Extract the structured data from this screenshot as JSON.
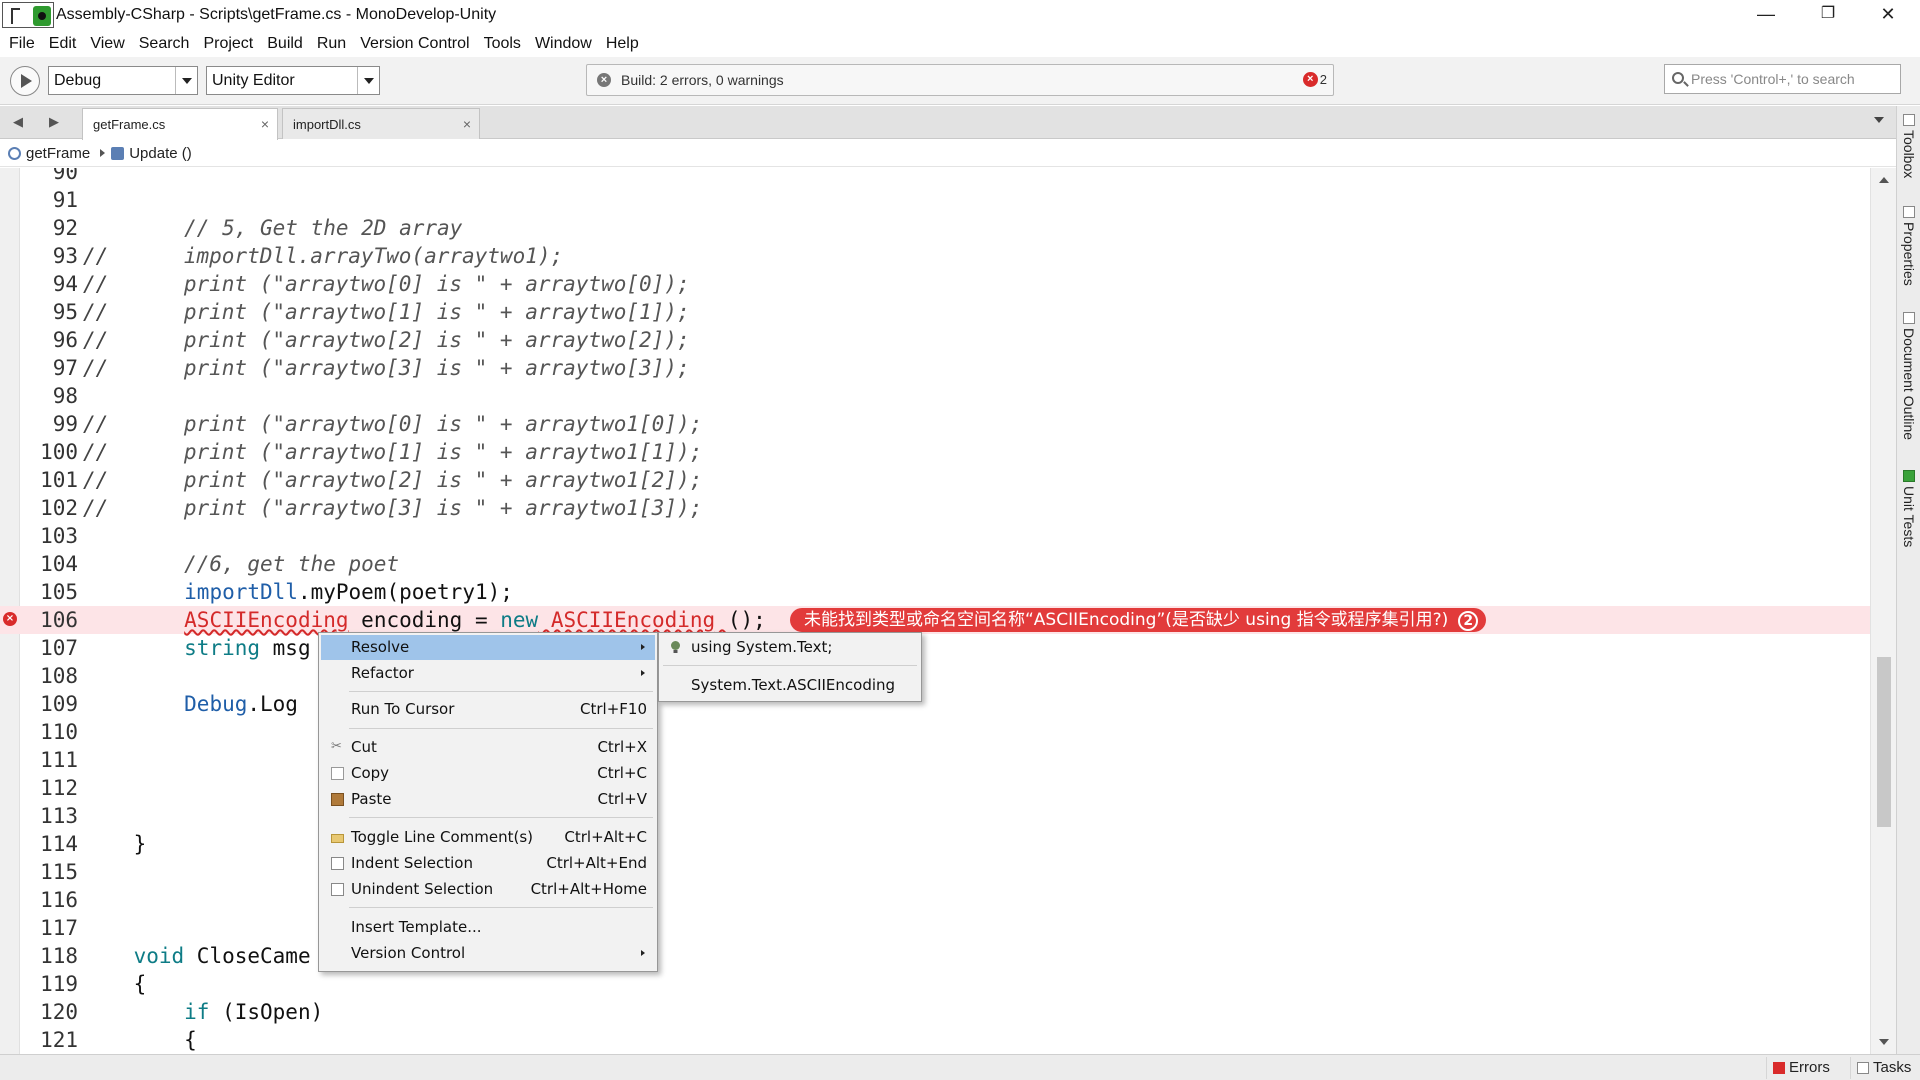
{
  "window": {
    "title": "Assembly-CSharp - Scripts\\getFrame.cs - MonoDevelop-Unity",
    "minimize": "—",
    "maximize": "❐",
    "close": "✕"
  },
  "menu": [
    "File",
    "Edit",
    "View",
    "Search",
    "Project",
    "Build",
    "Run",
    "Version Control",
    "Tools",
    "Window",
    "Help"
  ],
  "toolbar": {
    "configuration": "Debug",
    "target": "Unity Editor",
    "status_text": "Build: 2 errors, 0 warnings",
    "error_count": "2",
    "search_placeholder": "Press 'Control+,' to search"
  },
  "tabs": [
    {
      "label": "getFrame.cs",
      "close": "×",
      "active": true
    },
    {
      "label": "importDll.cs",
      "close": "×",
      "active": false
    }
  ],
  "breadcrumb": {
    "class_name": "getFrame",
    "method_name": "Update ()"
  },
  "code": {
    "lines": [
      {
        "n": "90",
        "prefix": "",
        "text": ""
      },
      {
        "n": "91",
        "prefix": "",
        "text": ""
      },
      {
        "n": "92",
        "prefix": "",
        "text": "        // 5, Get the 2D array"
      },
      {
        "n": "93",
        "prefix": "//",
        "text": "      importDll.arrayTwo(arraytwo1);"
      },
      {
        "n": "94",
        "prefix": "//",
        "text": "      print (\"arraytwo[0] is \" + arraytwo[0]);"
      },
      {
        "n": "95",
        "prefix": "//",
        "text": "      print (\"arraytwo[1] is \" + arraytwo[1]);"
      },
      {
        "n": "96",
        "prefix": "//",
        "text": "      print (\"arraytwo[2] is \" + arraytwo[2]);"
      },
      {
        "n": "97",
        "prefix": "//",
        "text": "      print (\"arraytwo[3] is \" + arraytwo[3]);"
      },
      {
        "n": "98",
        "prefix": "",
        "text": ""
      },
      {
        "n": "99",
        "prefix": "//",
        "text": "      print (\"arraytwo[0] is \" + arraytwo1[0]);"
      },
      {
        "n": "100",
        "prefix": "//",
        "text": "      print (\"arraytwo[1] is \" + arraytwo1[1]);"
      },
      {
        "n": "101",
        "prefix": "//",
        "text": "      print (\"arraytwo[2] is \" + arraytwo1[2]);"
      },
      {
        "n": "102",
        "prefix": "//",
        "text": "      print (\"arraytwo[3] is \" + arraytwo1[3]);"
      },
      {
        "n": "103",
        "prefix": "",
        "text": ""
      },
      {
        "n": "104",
        "prefix": "",
        "text": "        //6, get the poet"
      },
      {
        "n": "105",
        "prefix": "",
        "text": ""
      },
      {
        "n": "106",
        "prefix": "",
        "text": ""
      },
      {
        "n": "107",
        "prefix": "",
        "text": ""
      },
      {
        "n": "108",
        "prefix": "",
        "text": ""
      },
      {
        "n": "109",
        "prefix": "",
        "text": ""
      },
      {
        "n": "110",
        "prefix": "",
        "text": ""
      },
      {
        "n": "111",
        "prefix": "",
        "text": ""
      },
      {
        "n": "112",
        "prefix": "",
        "text": ""
      },
      {
        "n": "113",
        "prefix": "",
        "text": ""
      },
      {
        "n": "114",
        "prefix": "",
        "text": "    }"
      },
      {
        "n": "115",
        "prefix": "",
        "text": ""
      },
      {
        "n": "116",
        "prefix": "",
        "text": ""
      },
      {
        "n": "117",
        "prefix": "",
        "text": ""
      },
      {
        "n": "118",
        "prefix": "",
        "text": ""
      },
      {
        "n": "119",
        "prefix": "",
        "text": "    {"
      },
      {
        "n": "120",
        "prefix": "",
        "text": ""
      },
      {
        "n": "121",
        "prefix": "",
        "text": "        {"
      }
    ],
    "l105_obj": "importDll",
    "l105_rest": ".myPoem(poetry1);",
    "l106_type": "ASCIIEncoding",
    "l106_mid": " encoding = ",
    "l106_new": "new",
    "l106_ctor": " ASCIIEncoding ",
    "l106_end": "();",
    "l107_kw": "string",
    "l107_rest": " msg",
    "l109_obj": "Debug",
    "l109_rest": ".Log",
    "l118_kw": "void",
    "l118_rest": " CloseCame",
    "l120_kw": "if",
    "l120_rest": " (IsOpen)",
    "error_message": "未能找到类型或命名空间名称“ASCIIEncoding”(是否缺少 using 指令或程序集引用?)",
    "error_count": "2",
    "error_marker": "×"
  },
  "context_menu": {
    "resolve": "Resolve",
    "refactor": "Refactor",
    "run_to_cursor": "Run To Cursor",
    "run_to_cursor_sc": "Ctrl+F10",
    "cut": "Cut",
    "cut_sc": "Ctrl+X",
    "copy": "Copy",
    "copy_sc": "Ctrl+C",
    "paste": "Paste",
    "paste_sc": "Ctrl+V",
    "toggle_comment": "Toggle Line Comment(s)",
    "toggle_comment_sc": "Ctrl+Alt+C",
    "indent": "Indent Selection",
    "indent_sc": "Ctrl+Alt+End",
    "unindent": "Unindent Selection",
    "unindent_sc": "Ctrl+Alt+Home",
    "insert_template": "Insert Template...",
    "version_control": "Version Control"
  },
  "submenu": {
    "using": "using System.Text;",
    "qualified": "System.Text.ASCIIEncoding"
  },
  "dock": [
    "Toolbox",
    "Properties",
    "Document Outline",
    "Unit Tests"
  ],
  "statusbar": {
    "errors": "Errors",
    "tasks": "Tasks"
  },
  "colors": {
    "error": "#d92b2b",
    "error_line_bg": "#fde4e7",
    "keyword": "#0e7c86",
    "identifier": "#1f5ea8",
    "menu_highlight": "#9fc4ea"
  }
}
